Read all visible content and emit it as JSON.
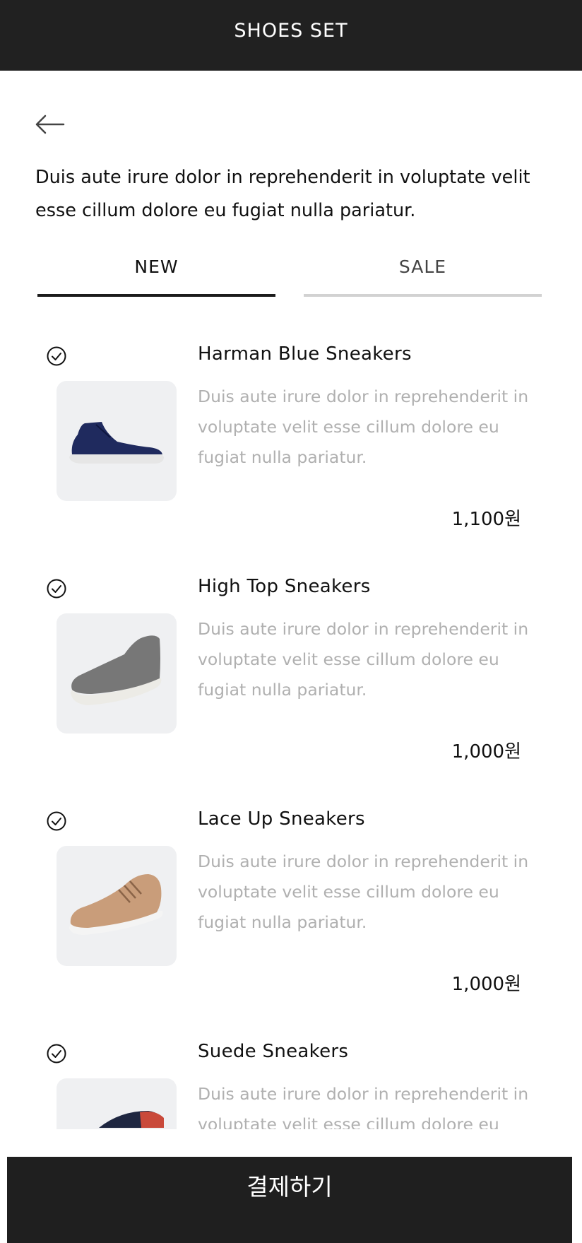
{
  "header": {
    "title": "SHOES SET"
  },
  "intro": "Duis aute irure dolor in reprehenderit in voluptate velit esse cillum dolore eu fugiat nulla pariatur.",
  "tabs": [
    {
      "label": "NEW",
      "active": true
    },
    {
      "label": "SALE",
      "active": false
    }
  ],
  "products": [
    {
      "name": "Harman Blue Sneakers",
      "description": "Duis aute irure dolor in reprehenderit in voluptate velit esse cillum dolore eu fugiat nulla pariatur.",
      "price": "1,100원",
      "checked": true,
      "shoe_color": "#1f2a5e"
    },
    {
      "name": "High Top Sneakers",
      "description": "Duis aute irure dolor in reprehenderit in voluptate velit esse cillum dolore eu fugiat nulla pariatur.",
      "price": "1,000원",
      "checked": true,
      "shoe_color": "#777777"
    },
    {
      "name": "Lace Up Sneakers",
      "description": "Duis aute irure dolor in reprehenderit in voluptate velit esse cillum dolore eu fugiat nulla pariatur.",
      "price": "1,000원",
      "checked": true,
      "shoe_color": "#c99d7a"
    },
    {
      "name": "Suede Sneakers",
      "description": "Duis aute irure dolor in reprehenderit in voluptate velit esse cillum dolore eu fugiat nulla pariatur.",
      "price": "",
      "checked": true,
      "shoe_color": "#1e2640"
    }
  ],
  "footer": {
    "pay_label": "결제하기"
  },
  "icons": {
    "back": "arrow-left-icon",
    "check": "check-circle-icon"
  },
  "colors": {
    "topbar": "#212121",
    "pay_button": "#1f1f1f",
    "thumb_bg": "#eff0f2",
    "muted_text": "#b0b0b0"
  }
}
